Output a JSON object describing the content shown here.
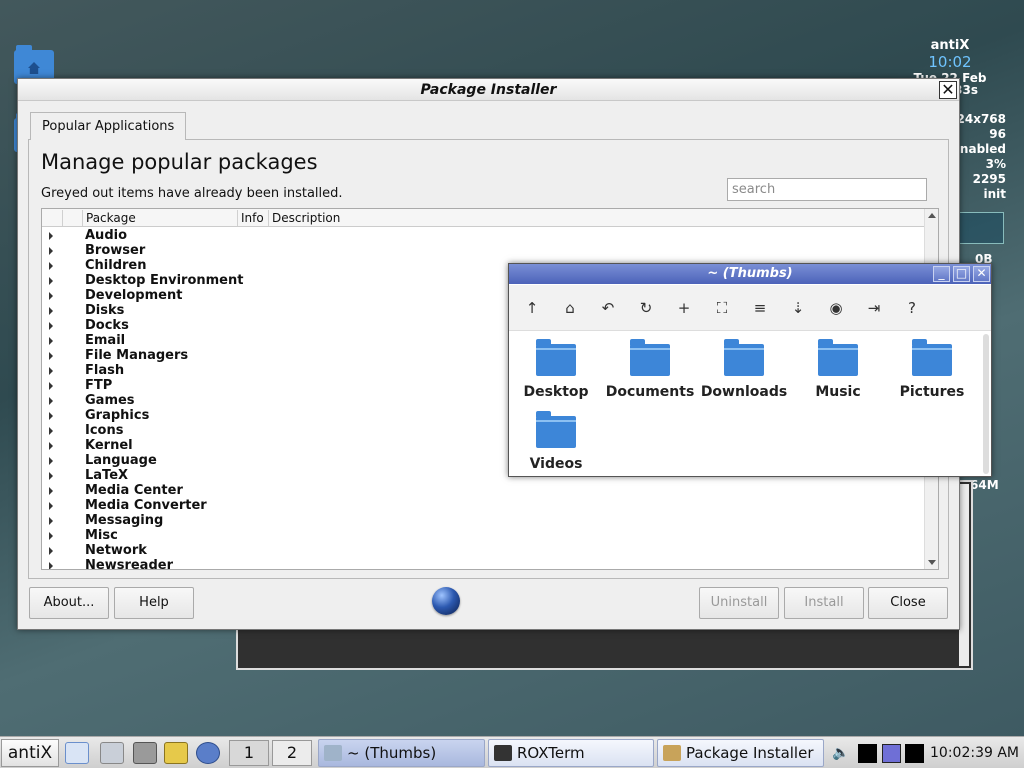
{
  "desktop": {
    "conky": {
      "title": "antiX",
      "time": "10:02",
      "date_partial": "Tue 22 Feb",
      "rows": [
        "33s",
        "24x768",
        "96",
        "nabled",
        "3%",
        "2295",
        "init"
      ],
      "extra": [
        "0B",
        "64M"
      ]
    }
  },
  "main_window": {
    "title": "Package Installer",
    "close_glyph": "✕",
    "tab_label": "Popular Applications",
    "heading": "Manage popular packages",
    "subtext": "Greyed out items have already been installed.",
    "search_placeholder": "search",
    "columns": [
      "Package",
      "Info",
      "Description"
    ],
    "categories": [
      "Audio",
      "Browser",
      "Children",
      "Desktop Environment",
      "Development",
      "Disks",
      "Docks",
      "Email",
      "File Managers",
      "Flash",
      "FTP",
      "Games",
      "Graphics",
      "Icons",
      "Kernel",
      "Language",
      "LaTeX",
      "Media Center",
      "Media Converter",
      "Messaging",
      "Misc",
      "Network",
      "Newsreader"
    ],
    "buttons": {
      "about": "About...",
      "help": "Help",
      "uninstall": "Uninstall",
      "install": "Install",
      "close": "Close"
    }
  },
  "file_manager": {
    "title": "~ (Thumbs)",
    "toolbar_icons": [
      "up-icon",
      "home-icon",
      "back-icon",
      "refresh-icon",
      "new-window-icon",
      "fullscreen-icon",
      "select-icon",
      "sort-icon",
      "show-hidden-icon",
      "details-icon",
      "help-icon"
    ],
    "toolbar_glyphs": [
      "↑",
      "⌂",
      "↶",
      "↻",
      "+",
      "⛶",
      "≡",
      "⇣",
      "◉",
      "⇥",
      "?"
    ],
    "folders": [
      "Desktop",
      "Documents",
      "Downloads",
      "Music",
      "Pictures",
      "Videos"
    ]
  },
  "taskbar": {
    "menu_label": "antiX",
    "workspace_1": "1",
    "workspace_2": "2",
    "tasks": [
      "~ (Thumbs)",
      "ROXTerm",
      "Package Installer"
    ],
    "clock": "10:02:39 AM",
    "colors": {
      "accent": "#4c63b9",
      "folder": "#3d86d8"
    }
  }
}
